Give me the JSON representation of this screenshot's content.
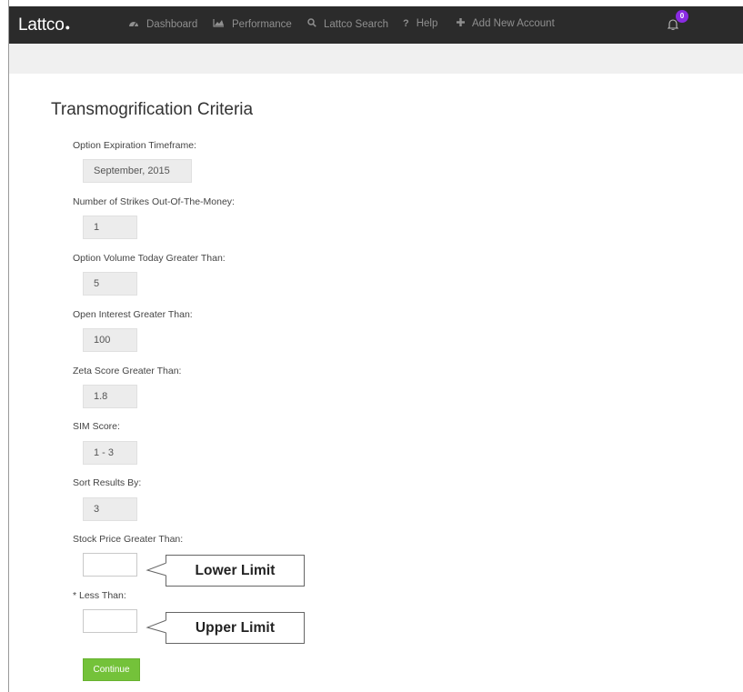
{
  "nav": {
    "brand": "Lattco",
    "items": [
      {
        "label": "Dashboard",
        "icon": "dashboard-icon",
        "glyph": "⚙"
      },
      {
        "label": "Performance",
        "icon": "area-chart-icon",
        "glyph": "▲"
      },
      {
        "label": "Lattco Search",
        "icon": "search-icon",
        "glyph": "🔍"
      },
      {
        "label": "Help",
        "icon": "question-icon",
        "glyph": "?"
      },
      {
        "label": "Add New Account",
        "icon": "plus-icon",
        "glyph": "✚"
      }
    ],
    "notification_count": "0",
    "badge_color": "#8a2be2"
  },
  "page": {
    "title": "Transmogrification Criteria"
  },
  "form": {
    "expiration": {
      "label": "Option Expiration Timeframe:",
      "value": "September, 2015"
    },
    "strikes": {
      "label": "Number of Strikes Out-Of-The-Money:",
      "value": "1"
    },
    "volume": {
      "label": "Option Volume Today Greater Than:",
      "value": "5"
    },
    "open_interest": {
      "label": "Open Interest Greater Than:",
      "value": "100"
    },
    "zeta": {
      "label": "Zeta Score Greater Than:",
      "value": "1.8"
    },
    "sim": {
      "label": "SIM Score:",
      "value": "1 - 3"
    },
    "sort": {
      "label": "Sort Results By:",
      "value": "3"
    },
    "stock_price_min": {
      "label": "Stock Price Greater Than:",
      "value": ""
    },
    "stock_price_max": {
      "label": "* Less Than:",
      "value": ""
    },
    "continue_label": "Continue"
  },
  "callouts": {
    "lower": "Lower Limit",
    "upper": "Upper Limit"
  },
  "colors": {
    "navbar": "#2b2b2b",
    "continue": "#74c23a"
  }
}
